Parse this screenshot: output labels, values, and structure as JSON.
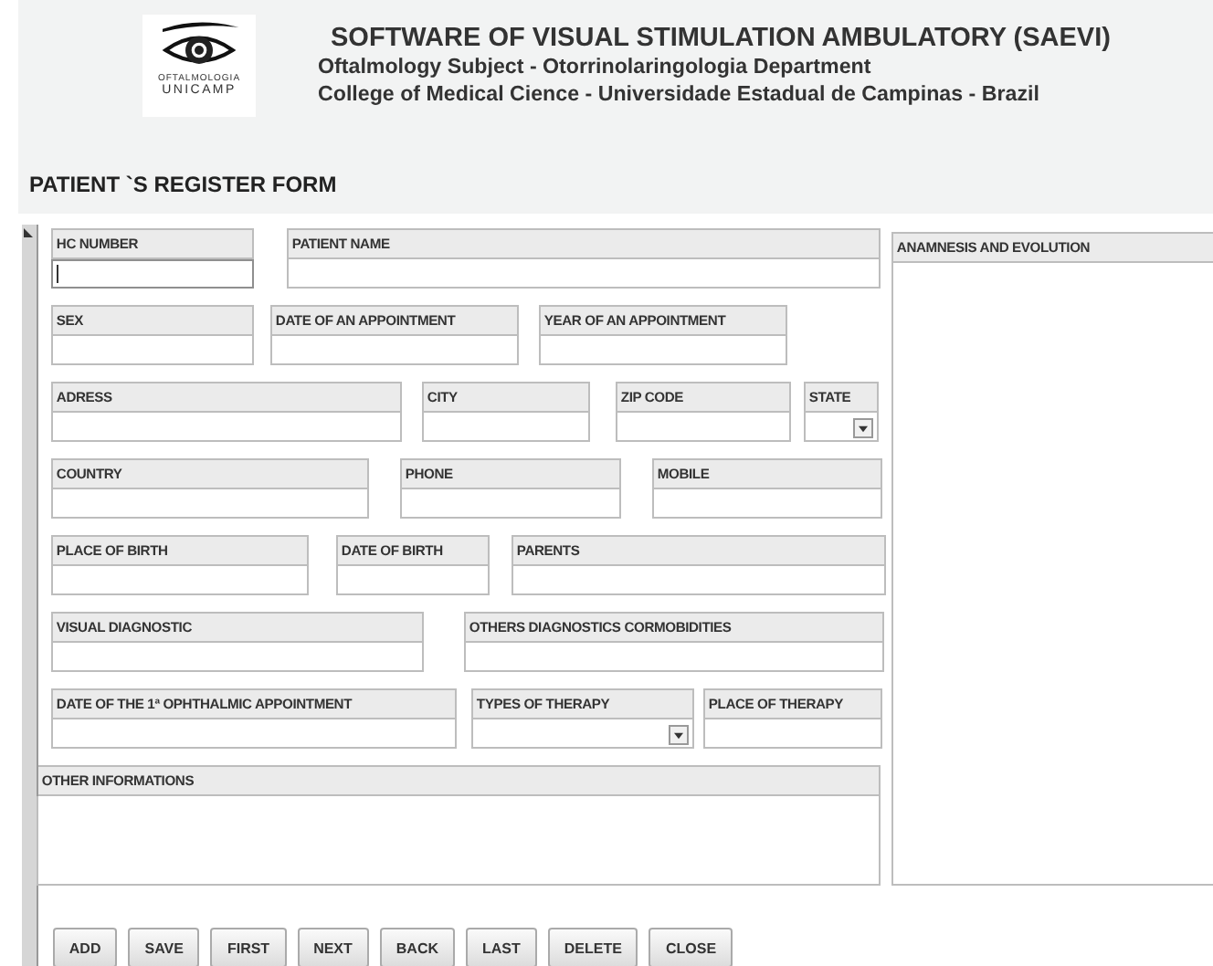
{
  "header": {
    "logo_lines": [
      "OFTALMOLOGIA",
      "UNICAMP"
    ],
    "title": "SOFTWARE  OF VISUAL STIMULATION AMBULATORY (SAEVI)",
    "subtitle_lines": [
      "Oftalmology Subject - Otorrinolaringologia Department",
      "College of Medical Cience - Universidade Estadual de Campinas  -  Brazil"
    ]
  },
  "form": {
    "title": "PATIENT `S REGISTER FORM",
    "rows": [
      {
        "fields": [
          {
            "label": "HC NUMBER",
            "kind": "text",
            "focused": true
          },
          {
            "label": "PATIENT NAME",
            "kind": "text",
            "focused": false
          }
        ]
      },
      {
        "fields": [
          {
            "label": "SEX",
            "kind": "text",
            "focused": false
          },
          {
            "label": "DATE OF AN APPOINTMENT",
            "kind": "text",
            "focused": false
          },
          {
            "label": "YEAR OF AN APPOINTMENT",
            "kind": "text",
            "focused": false
          }
        ]
      },
      {
        "fields": [
          {
            "label": "ADRESS",
            "kind": "text",
            "focused": false
          },
          {
            "label": "CITY",
            "kind": "text",
            "focused": false
          },
          {
            "label": "ZIP CODE",
            "kind": "text",
            "focused": false
          },
          {
            "label": "STATE",
            "kind": "dropdown",
            "focused": false
          }
        ]
      },
      {
        "fields": [
          {
            "label": "COUNTRY",
            "kind": "text",
            "focused": false
          },
          {
            "label": "PHONE",
            "kind": "text",
            "focused": false
          },
          {
            "label": "MOBILE",
            "kind": "text",
            "focused": false
          }
        ]
      },
      {
        "fields": [
          {
            "label": "PLACE OF BIRTH",
            "kind": "text",
            "focused": false
          },
          {
            "label": "DATE OF BIRTH",
            "kind": "text",
            "focused": false
          },
          {
            "label": "PARENTS",
            "kind": "text",
            "focused": false
          }
        ]
      },
      {
        "fields": [
          {
            "label": "VISUAL DIAGNOSTIC",
            "kind": "text",
            "focused": false
          },
          {
            "label": "OTHERS DIAGNOSTICS CORMOBIDITIES",
            "kind": "text",
            "focused": false
          }
        ]
      },
      {
        "fields": [
          {
            "label": "DATE OF THE 1ª OPHTHALMIC APPOINTMENT",
            "kind": "text",
            "focused": false
          },
          {
            "label": "TYPES OF THERAPY",
            "kind": "dropdown",
            "focused": false
          },
          {
            "label": "PLACE OF THERAPY",
            "kind": "text",
            "focused": false
          }
        ]
      },
      {
        "fields": [
          {
            "label": "OTHER INFORMATIONS",
            "kind": "textarea",
            "focused": false
          }
        ]
      }
    ],
    "side_panel": {
      "label": "ANAMNESIS AND EVOLUTION"
    }
  },
  "buttons": [
    "ADD",
    "SAVE",
    "FIRST",
    "NEXT",
    "BACK",
    "LAST",
    "DELETE",
    "CLOSE"
  ]
}
